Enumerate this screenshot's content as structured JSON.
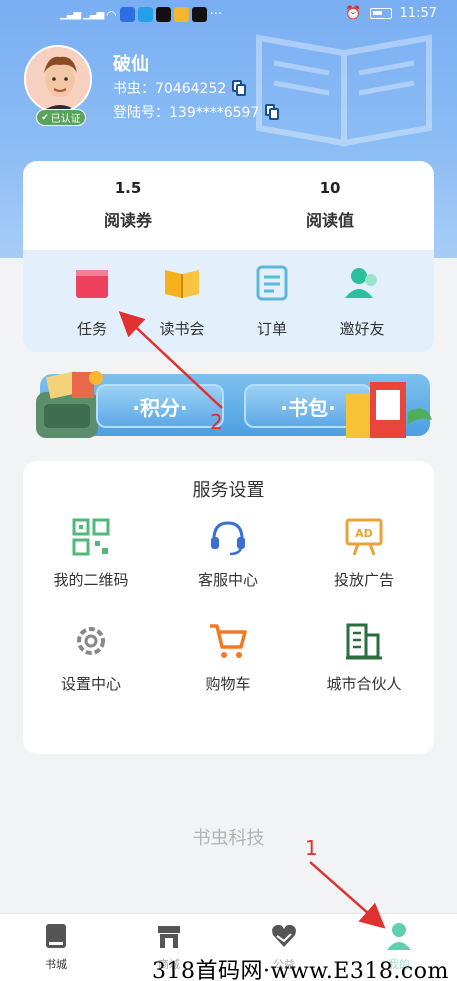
{
  "status_bar": {
    "time": "11:57",
    "more": "···"
  },
  "user": {
    "name": "破仙",
    "id_label": "书虫：",
    "id_value": "70464252",
    "phone_label": "登陆号：",
    "phone_value": "139****6597",
    "verified_badge": "已认证"
  },
  "stats": [
    {
      "value": "1.5",
      "label": "阅读券"
    },
    {
      "value": "10",
      "label": "阅读值"
    }
  ],
  "quick_actions": [
    {
      "label": "任务",
      "icon": "task-icon"
    },
    {
      "label": "读书会",
      "icon": "book-club-icon"
    },
    {
      "label": "订单",
      "icon": "order-icon"
    },
    {
      "label": "邀好友",
      "icon": "invite-friend-icon"
    }
  ],
  "banner": {
    "points_label": "·积分·",
    "bag_label": "·书包·"
  },
  "services": {
    "title": "服务设置",
    "items": [
      {
        "label": "我的二维码",
        "icon": "qr-code-icon",
        "color": "#4fb87a"
      },
      {
        "label": "客服中心",
        "icon": "headset-icon",
        "color": "#3b6fd4"
      },
      {
        "label": "投放广告",
        "icon": "ad-board-icon",
        "color": "#e8a23b"
      },
      {
        "label": "设置中心",
        "icon": "gear-icon",
        "color": "#888888"
      },
      {
        "label": "购物车",
        "icon": "cart-icon",
        "color": "#f07a22"
      },
      {
        "label": "城市合伙人",
        "icon": "city-building-icon",
        "color": "#2a6e3c"
      }
    ]
  },
  "footer_brand": "书虫科技",
  "tabs": [
    {
      "label": "书城",
      "icon": "book-icon"
    },
    {
      "label": "商城",
      "icon": "store-icon"
    },
    {
      "label": "公益",
      "icon": "charity-heart-icon"
    },
    {
      "label": "我的",
      "icon": "profile-icon"
    }
  ],
  "watermark": "318首码网·www.E318.com",
  "annotations": {
    "arrow_1": "1",
    "arrow_2": "2"
  },
  "colors": {
    "hero_blue": "#79aef3",
    "quick_bg": "#e3f0fb",
    "annotation_red": "#e03030"
  }
}
